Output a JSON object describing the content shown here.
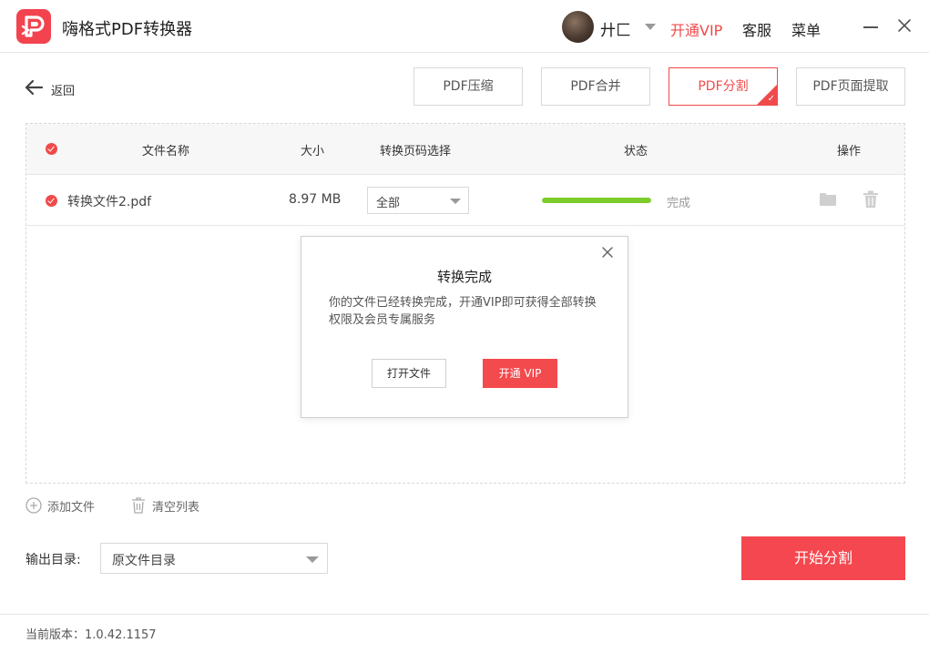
{
  "app": {
    "title": "嗨格式PDF转换器",
    "user_name": "廾匚",
    "vip_label": "开通VIP",
    "service_label": "客服",
    "menu_label": "菜单",
    "accent_color": "#f04a4a"
  },
  "toolbar": {
    "back_label": "返回",
    "tabs": [
      {
        "label": "PDF压缩",
        "active": false
      },
      {
        "label": "PDF合并",
        "active": false
      },
      {
        "label": "PDF分割",
        "active": true
      },
      {
        "label": "PDF页面提取",
        "active": false
      }
    ]
  },
  "table": {
    "headers": {
      "name": "文件名称",
      "size": "大小",
      "page_select": "转换页码选择",
      "status": "状态",
      "actions": "操作"
    },
    "rows": [
      {
        "name": "转换文件2.pdf",
        "size": "8.97 MB",
        "page_option": "全部",
        "progress": 1.0,
        "status": "完成",
        "progress_color": "#7ccd2b"
      }
    ]
  },
  "dialog": {
    "title": "转换完成",
    "message": "你的文件已经转换完成，开通VIP即可获得全部转换权限及会员专属服务",
    "open_file_label": "打开文件",
    "vip_button_label": "开通 VIP"
  },
  "actions": {
    "add_file_label": "添加文件",
    "clear_list_label": "清空列表"
  },
  "output": {
    "label": "输出目录:",
    "selected": "原文件目录"
  },
  "start_button_label": "开始分割",
  "footer": {
    "version_text": "当前版本：1.0.42.1157"
  }
}
